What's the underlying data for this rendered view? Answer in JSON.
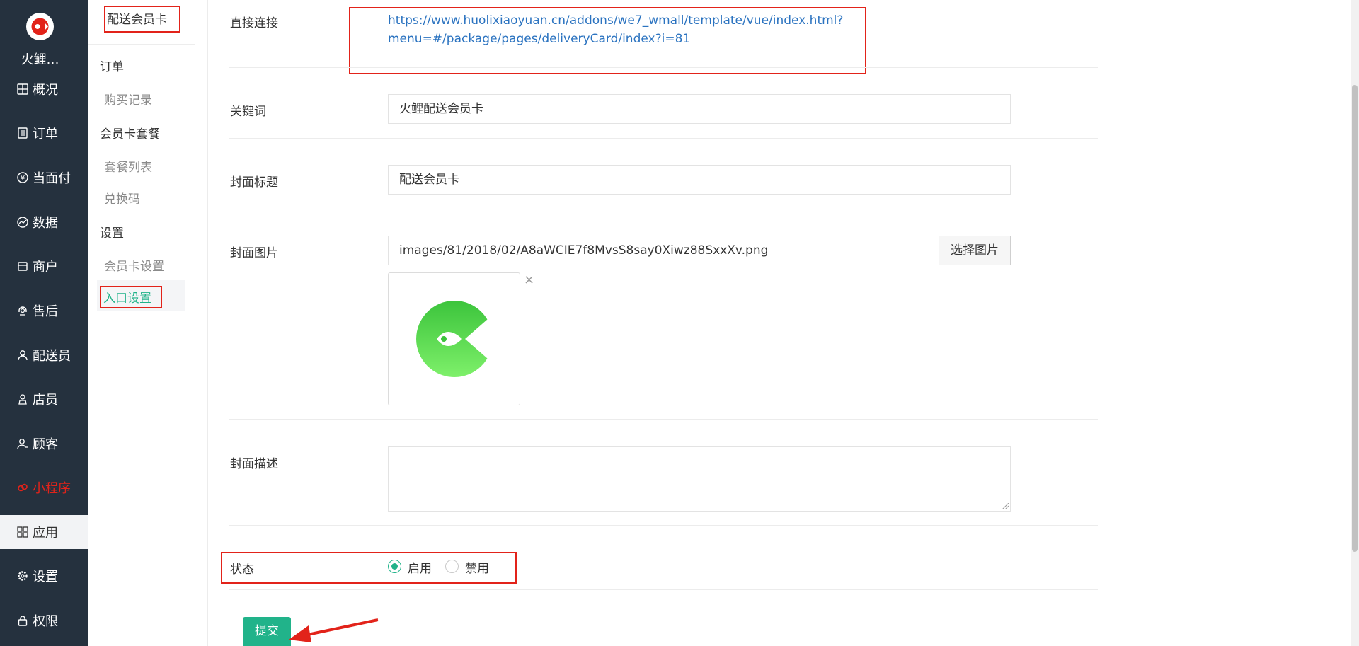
{
  "sidebar": {
    "brand": "火鲤…",
    "items": [
      {
        "label": "概况",
        "icon": "dashboard-icon"
      },
      {
        "label": "订单",
        "icon": "order-list-icon"
      },
      {
        "label": "当面付",
        "icon": "yen-icon"
      },
      {
        "label": "数据",
        "icon": "chart-icon"
      },
      {
        "label": "商户",
        "icon": "store-icon"
      },
      {
        "label": "售后",
        "icon": "headset-icon"
      },
      {
        "label": "配送员",
        "icon": "courier-icon"
      },
      {
        "label": "店员",
        "icon": "clerk-icon"
      },
      {
        "label": "顾客",
        "icon": "customer-icon"
      },
      {
        "label": "小程序",
        "icon": "miniprogram-icon"
      },
      {
        "label": "应用",
        "icon": "apps-icon"
      },
      {
        "label": "设置",
        "icon": "gear-icon"
      },
      {
        "label": "权限",
        "icon": "lock-icon"
      }
    ]
  },
  "submenu": {
    "title": "配送会员卡",
    "groups": [
      {
        "label": "订单",
        "links": [
          "购买记录"
        ]
      },
      {
        "label": "会员卡套餐",
        "links": [
          "套餐列表",
          "兑换码"
        ]
      },
      {
        "label": "设置",
        "links": [
          "会员卡设置",
          "入口设置"
        ]
      }
    ],
    "current": "入口设置"
  },
  "form": {
    "direct_link": {
      "label": "直接连接",
      "line1": "https://www.huolixiaoyuan.cn/addons/we7_wmall/template/vue/index.html?",
      "line2": "menu=#/package/pages/deliveryCard/index?i=81"
    },
    "keyword": {
      "label": "关键词",
      "value": "火鲤配送会员卡"
    },
    "cover_title": {
      "label": "封面标题",
      "value": "配送会员卡"
    },
    "cover_image": {
      "label": "封面图片",
      "value": "images/81/2018/02/A8aWCIE7f8MvsS8say0Xiwz88SxxXv.png",
      "button": "选择图片",
      "remove": "×"
    },
    "cover_desc": {
      "label": "封面描述",
      "value": ""
    },
    "status": {
      "label": "状态",
      "options": [
        "启用",
        "禁用"
      ],
      "selected": "启用"
    },
    "submit": "提交"
  },
  "colors": {
    "sidebar_bg": "#25313e",
    "accent_green": "#21b38a",
    "highlight_red": "#e2231a",
    "link_blue": "#2b73c0"
  }
}
